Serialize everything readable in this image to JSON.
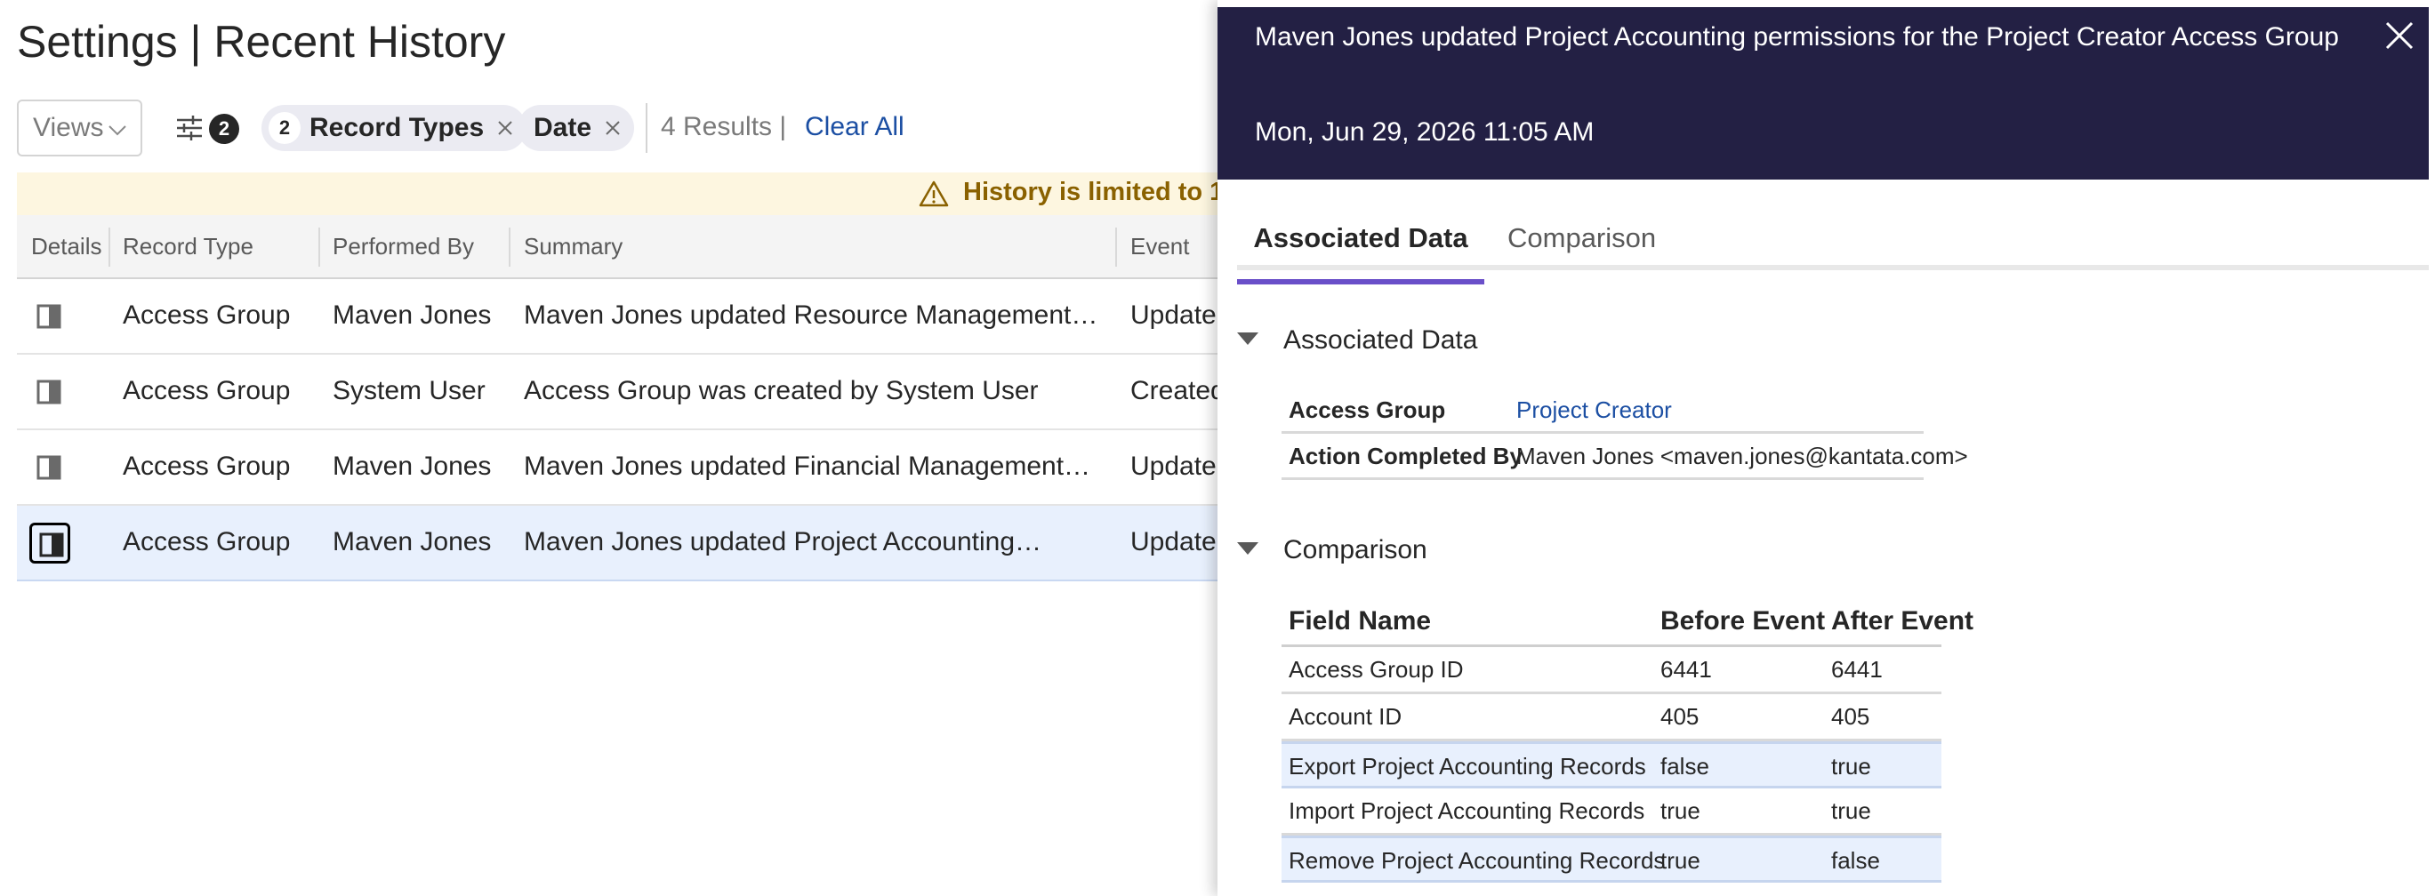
{
  "page": {
    "title": "Settings | Recent History"
  },
  "toolbar": {
    "views_label": "Views",
    "filter_count": "2",
    "chips": [
      {
        "count": "2",
        "label": "Record Types"
      },
      {
        "label": "Date"
      }
    ],
    "results": "4 Results",
    "separator": "|",
    "clear_all": "Clear All"
  },
  "warning": {
    "text": "History is limited to 1"
  },
  "table": {
    "headers": [
      "Details",
      "Record Type",
      "Performed By",
      "Summary",
      "Event"
    ],
    "rows": [
      {
        "record_type": "Access Group",
        "performed_by": "Maven Jones",
        "summary": "Maven Jones updated Resource Management…",
        "event": "Update"
      },
      {
        "record_type": "Access Group",
        "performed_by": "System User",
        "summary": "Access Group was created by System User",
        "event": "Created"
      },
      {
        "record_type": "Access Group",
        "performed_by": "Maven Jones",
        "summary": "Maven Jones updated Financial Management…",
        "event": "Update"
      },
      {
        "record_type": "Access Group",
        "performed_by": "Maven Jones",
        "summary": "Maven Jones updated Project Accounting…",
        "event": "Update"
      }
    ]
  },
  "panel": {
    "title": "Maven Jones updated Project Accounting permissions for the Project Creator Access Group",
    "date": "Mon, Jun 29, 2026 11:05 AM",
    "tabs": [
      "Associated Data",
      "Comparison"
    ],
    "associated": {
      "heading": "Associated Data",
      "rows": [
        {
          "key": "Access Group",
          "value": "Project Creator"
        },
        {
          "key": "Action Completed By",
          "value": "Maven Jones <maven.jones@kantata.com>"
        }
      ]
    },
    "comparison": {
      "heading": "Comparison",
      "headers": [
        "Field Name",
        "Before Event",
        "After Event"
      ],
      "rows": [
        {
          "field": "Access Group ID",
          "before": "6441",
          "after": "6441"
        },
        {
          "field": "Account ID",
          "before": "405",
          "after": "405"
        },
        {
          "field": "Export Project Accounting Records",
          "before": "false",
          "after": "true"
        },
        {
          "field": "Import Project Accounting Records",
          "before": "true",
          "after": "true"
        },
        {
          "field": "Remove Project Accounting Records",
          "before": "true",
          "after": "false"
        }
      ]
    }
  },
  "colors": {
    "panel_header_bg": "#232044",
    "active_tab_underline": "#6a4fc9",
    "link": "#1c4fa3",
    "warning_bg": "#fdf6e0",
    "warning_text": "#8a6100",
    "selected_row_bg": "#e8f0fd"
  },
  "icons": [
    "chevron-down-icon",
    "filter-sliders-icon",
    "close-icon",
    "warning-icon",
    "details-panel-icon",
    "triangle-down-icon"
  ]
}
